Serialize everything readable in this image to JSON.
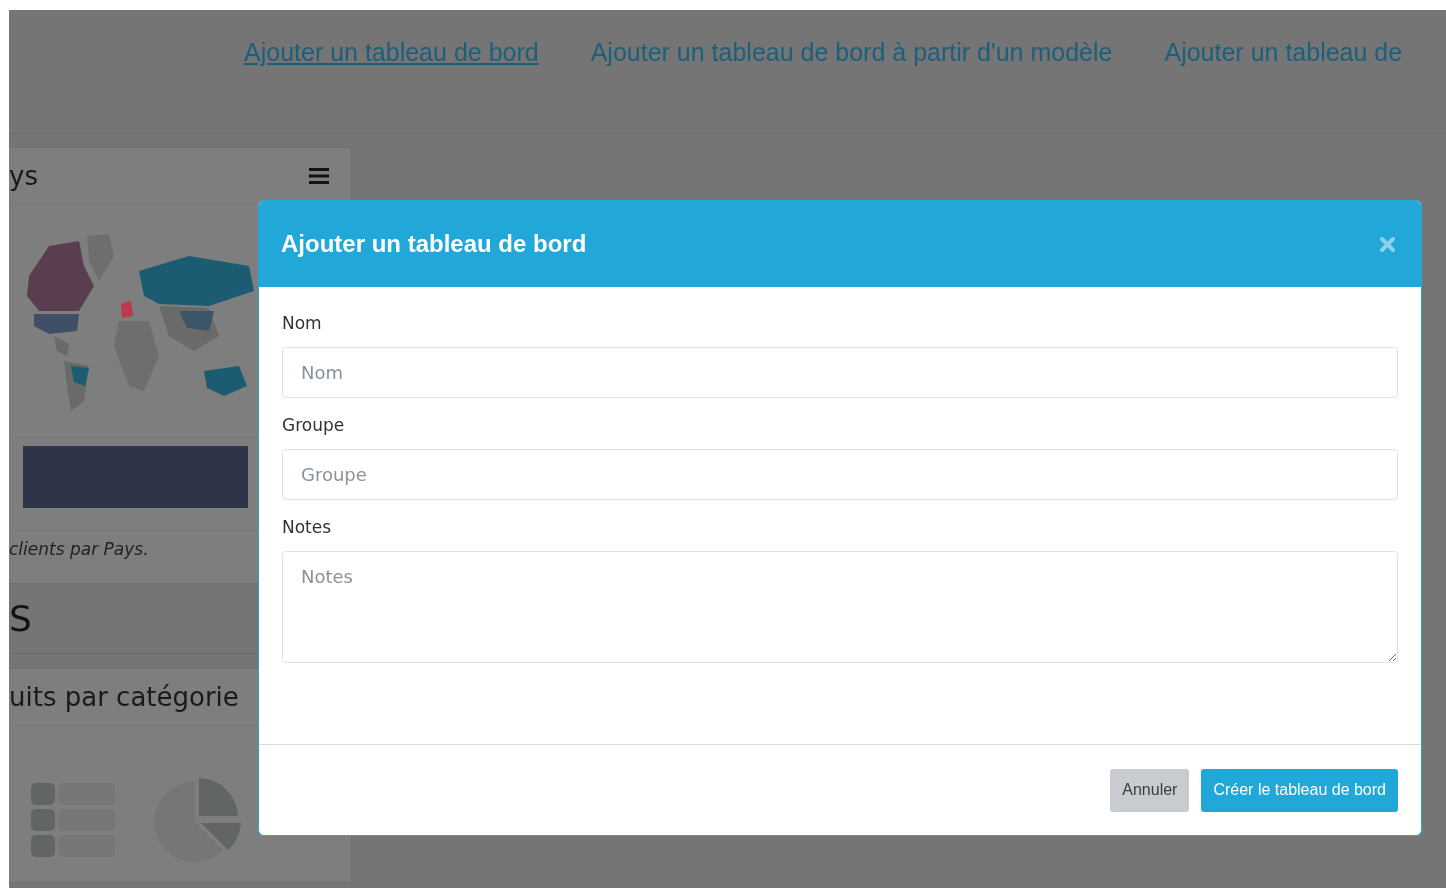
{
  "nav_links": [
    {
      "label": "Ajouter un tableau de bord",
      "selected": true
    },
    {
      "label": "Ajouter un tableau de bord à partir d'un modèle",
      "selected": false
    },
    {
      "label": "Ajouter un tableau de",
      "selected": false
    }
  ],
  "map_panel": {
    "title": "ys",
    "caption": "clients par Pays."
  },
  "section_title": "S",
  "category_panel": {
    "title": "uits par catégorie"
  },
  "modal": {
    "title": "Ajouter un tableau de bord",
    "fields": [
      {
        "kind": "input",
        "label": "Nom",
        "placeholder": "Nom"
      },
      {
        "kind": "input",
        "label": "Groupe",
        "placeholder": "Groupe"
      },
      {
        "kind": "textarea",
        "label": "Notes",
        "placeholder": "Notes"
      }
    ],
    "buttons": [
      {
        "kind": "secondary",
        "label": "Annuler"
      },
      {
        "kind": "primary",
        "label": "Créer le tableau de bord"
      }
    ]
  }
}
